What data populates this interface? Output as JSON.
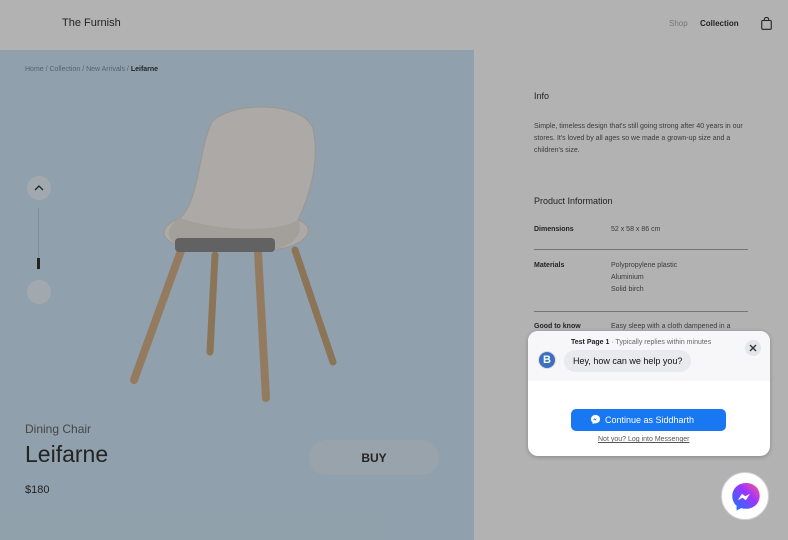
{
  "header": {
    "brand": "The Furnish",
    "nav": {
      "shop": "Shop",
      "collection": "Collection"
    },
    "bag_icon": "shopping-bag-icon"
  },
  "breadcrumb": {
    "trail": "Home / Collection / New Arrivals /",
    "current": "Leifarne"
  },
  "product": {
    "category": "Dining Chair",
    "name": "Leifarne",
    "price": "$180",
    "buy_label": "BUY",
    "panel_color": "#cfe6f7",
    "image_icon": "chair-image",
    "thumb_nav_icons": [
      "chevron-up-icon",
      "chevron-down-icon"
    ]
  },
  "info": {
    "title": "Info",
    "text": "Simple, timeless design that's still going strong after 40 years in our stores. It's loved by all ages so we made a grown-up size and a children's size.",
    "product_info_title": "Product Information",
    "specs": [
      {
        "label": "Dimensions",
        "value": "52 x 58 x 86 cm"
      },
      {
        "label": "Materials",
        "value": "Polypropylene plastic\nAluminium\nSolid birch"
      },
      {
        "label": "Good to know",
        "value": "Easy sleep with a cloth dampened in a"
      }
    ]
  },
  "chat": {
    "page_name": "Test Page 1",
    "reply_time": "· Typically replies within minutes",
    "greeting": "Hey, how can we help you?",
    "avatar_letter": "B",
    "continue_label": "Continue as Siddharth",
    "not_you_label": "Not you? Log into Messenger",
    "accent": "#1a77f2",
    "close_icon": "close-icon",
    "launcher_icon": "messenger-icon"
  }
}
